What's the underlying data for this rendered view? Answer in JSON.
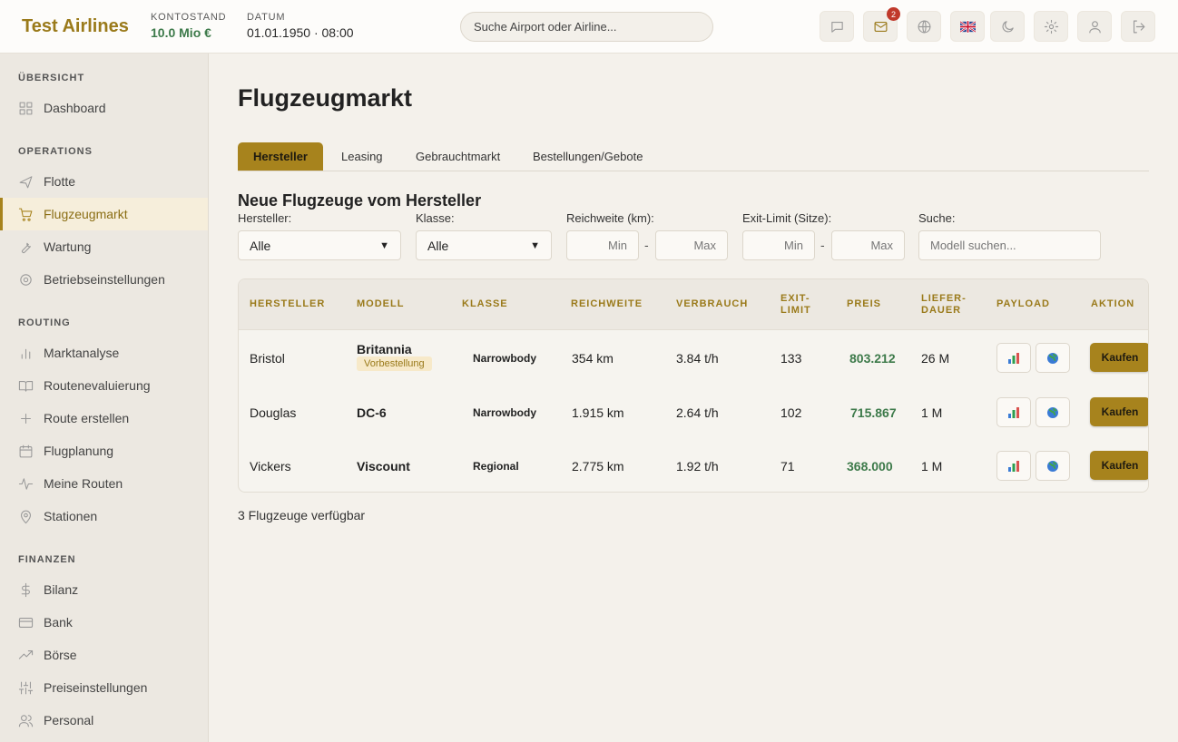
{
  "header": {
    "brand": "Test Airlines",
    "balance_label": "KONTOSTAND",
    "balance_value": "10.0 Mio €",
    "date_label": "DATUM",
    "date_value": "01.01.1950 · 08:00",
    "search_placeholder": "Suche Airport oder Airline...",
    "mail_badge": "2"
  },
  "sidebar": {
    "sections": [
      {
        "title": "ÜBERSICHT",
        "items": [
          {
            "label": "Dashboard",
            "icon": "dashboard-icon"
          }
        ]
      },
      {
        "title": "OPERATIONS",
        "items": [
          {
            "label": "Flotte",
            "icon": "plane-icon"
          },
          {
            "label": "Flugzeugmarkt",
            "icon": "cart-icon",
            "active": true
          },
          {
            "label": "Wartung",
            "icon": "wrench-icon"
          },
          {
            "label": "Betriebseinstellungen",
            "icon": "gear-icon"
          }
        ]
      },
      {
        "title": "ROUTING",
        "items": [
          {
            "label": "Marktanalyse",
            "icon": "bar-chart-icon"
          },
          {
            "label": "Routenevaluierung",
            "icon": "book-icon"
          },
          {
            "label": "Route erstellen",
            "icon": "plus-icon"
          },
          {
            "label": "Flugplanung",
            "icon": "calendar-icon"
          },
          {
            "label": "Meine Routen",
            "icon": "activity-icon"
          },
          {
            "label": "Stationen",
            "icon": "map-pin-icon"
          }
        ]
      },
      {
        "title": "FINANZEN",
        "items": [
          {
            "label": "Bilanz",
            "icon": "dollar-icon"
          },
          {
            "label": "Bank",
            "icon": "credit-card-icon"
          },
          {
            "label": "Börse",
            "icon": "trending-up-icon"
          },
          {
            "label": "Preiseinstellungen",
            "icon": "sliders-icon"
          },
          {
            "label": "Personal",
            "icon": "users-icon"
          }
        ]
      }
    ]
  },
  "main": {
    "title": "Flugzeugmarkt",
    "tabs": [
      {
        "label": "Hersteller",
        "active": true
      },
      {
        "label": "Leasing"
      },
      {
        "label": "Gebrauchtmarkt"
      },
      {
        "label": "Bestellungen/Gebote"
      }
    ],
    "subtitle": "Neue Flugzeuge vom Hersteller",
    "filters": {
      "hersteller_label": "Hersteller:",
      "hersteller_value": "Alle",
      "klasse_label": "Klasse:",
      "klasse_value": "Alle",
      "reichweite_label": "Reichweite (km):",
      "min_placeholder": "Min",
      "max_placeholder": "Max",
      "exit_label": "Exit-Limit (Sitze):",
      "suche_label": "Suche:",
      "suche_placeholder": "Modell suchen...",
      "range_separator": "-"
    },
    "table": {
      "headers": {
        "hersteller": "HERSTELLER",
        "modell": "MODELL",
        "klasse": "KLASSE",
        "reichweite": "REICHWEITE",
        "verbrauch": "VERBRAUCH",
        "exit": "EXIT-\nLIMIT",
        "preis": "PREIS",
        "liefer": "LIEFER-\nDAUER",
        "payload": "PAYLOAD",
        "aktion": "AKTION"
      },
      "rows": [
        {
          "hersteller": "Bristol",
          "modell": "Britannia",
          "tag": "Vorbestellung",
          "klasse": "Narrowbody",
          "reichweite": "354 km",
          "verbrauch": "3.84 t/h",
          "exit": "133",
          "preis": "803.212",
          "liefer": "26 M",
          "action": "Kaufen"
        },
        {
          "hersteller": "Douglas",
          "modell": "DC-6",
          "tag": "",
          "klasse": "Narrowbody",
          "reichweite": "1.915 km",
          "verbrauch": "2.64 t/h",
          "exit": "102",
          "preis": "715.867",
          "liefer": "1 M",
          "action": "Kaufen"
        },
        {
          "hersteller": "Vickers",
          "modell": "Viscount",
          "tag": "",
          "klasse": "Regional",
          "reichweite": "2.775 km",
          "verbrauch": "1.92 t/h",
          "exit": "71",
          "preis": "368.000",
          "liefer": "1 M",
          "action": "Kaufen"
        }
      ]
    },
    "count_text": "3 Flugzeuge verfügbar"
  }
}
